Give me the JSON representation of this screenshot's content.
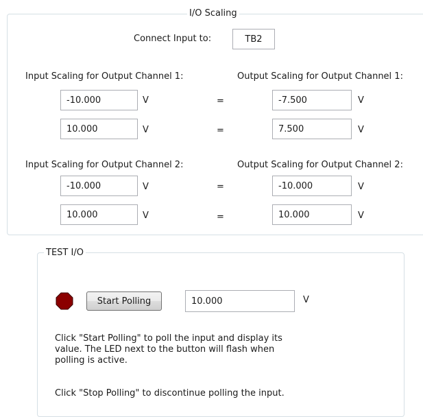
{
  "io_scaling": {
    "title": "I/O Scaling",
    "connect_label": "Connect Input to:",
    "connect_value": "TB2",
    "channels": [
      {
        "input_label": "Input Scaling for Output Channel 1:",
        "output_label": "Output Scaling for Output Channel 1:",
        "rows": [
          {
            "input": "-10.000",
            "input_unit": "V",
            "equals": "=",
            "output": "-7.500",
            "output_unit": "V"
          },
          {
            "input": "10.000",
            "input_unit": "V",
            "equals": "=",
            "output": "7.500",
            "output_unit": "V"
          }
        ]
      },
      {
        "input_label": "Input Scaling for Output Channel 2:",
        "output_label": "Output Scaling for Output Channel 2:",
        "rows": [
          {
            "input": "-10.000",
            "input_unit": "V",
            "equals": "=",
            "output": "-10.000",
            "output_unit": "V"
          },
          {
            "input": "10.000",
            "input_unit": "V",
            "equals": "=",
            "output": "10.000",
            "output_unit": "V"
          }
        ]
      }
    ]
  },
  "test_io": {
    "title": "TEST I/O",
    "led_color": "#8b0000",
    "start_button": "Start Polling",
    "value": "10.000",
    "value_unit": "V",
    "desc1_lines": [
      "Click \"Start Polling\" to poll the input and display its",
      "value. The LED next to the button will flash when",
      "polling is active."
    ],
    "desc2": "Click \"Stop Polling\" to discontinue polling the input."
  }
}
